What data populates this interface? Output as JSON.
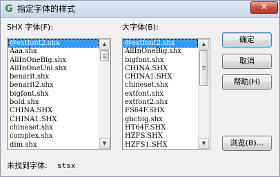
{
  "window": {
    "title": "指定字体的样式",
    "close_glyph": "✕",
    "app_icon": "autocad-g-icon"
  },
  "shx_fonts": {
    "label": "SHX 字体(F):",
    "items": [
      "@extfont2.shx",
      "Aaa.shx",
      "AllInOneBig.shx",
      "AllInOneUni.shx",
      "benarit.shx",
      "benarit2.shx",
      "bigfont.shx",
      "bold.shx",
      "CHINA.SHX",
      "CHINA1.SHX",
      "chineset.shx",
      "complex.shx",
      "dim.shx"
    ],
    "selected_index": 0
  },
  "big_fonts": {
    "label": "大字体(B):",
    "items": [
      "@extfont2.shx",
      "AllInOneBig.shx",
      "bigfont.shx",
      "CHINA.SHX",
      "CHINA1.SHX",
      "chineset.shx",
      "extfont.shx",
      "extfont2.shx",
      "FS64F.SHX",
      "gbcbig.shx",
      "HT64F.SHX",
      "HZFS.SHX",
      "HZFS1.SHX"
    ],
    "selected_index": 0
  },
  "buttons": {
    "ok": "确定",
    "cancel": "取消",
    "help": "帮助(H)",
    "browse": "浏览(B)..."
  },
  "status": {
    "label": "未找到字体:",
    "font": "stsx"
  }
}
